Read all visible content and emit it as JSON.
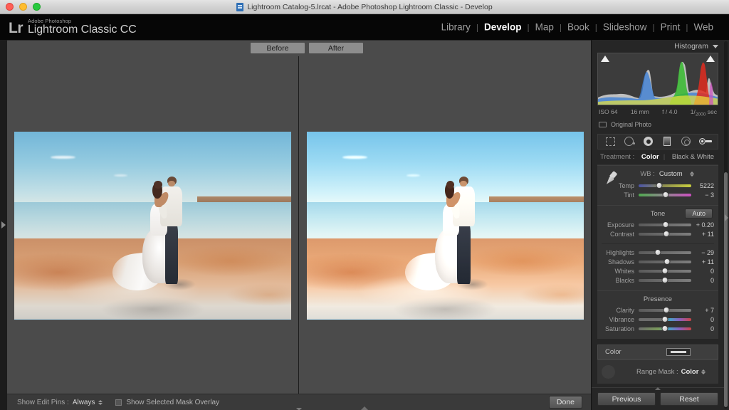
{
  "window": {
    "title": "Lightroom Catalog-5.lrcat - Adobe Photoshop Lightroom Classic - Develop",
    "doc_icon": "document-icon",
    "traffic": {
      "close": "close-button",
      "minimize": "minimize-button",
      "zoom": "zoom-button"
    }
  },
  "header": {
    "logo_mark": "Lr",
    "brand_sup": "Adobe Photoshop",
    "brand_name": "Lightroom Classic CC",
    "separator": "|",
    "modules": [
      {
        "label": "Library",
        "active": false
      },
      {
        "label": "Develop",
        "active": true
      },
      {
        "label": "Map",
        "active": false
      },
      {
        "label": "Book",
        "active": false
      },
      {
        "label": "Slideshow",
        "active": false
      },
      {
        "label": "Print",
        "active": false
      },
      {
        "label": "Web",
        "active": false
      }
    ]
  },
  "viewer": {
    "before_label": "Before",
    "after_label": "After"
  },
  "toolbar": {
    "show_edit_pins_label": "Show Edit Pins :",
    "show_edit_pins_value": "Always",
    "mask_overlay_label": "Show Selected Mask Overlay",
    "mask_overlay_checked": false,
    "done_label": "Done"
  },
  "right_panel": {
    "histogram": {
      "title": "Histogram",
      "iso": "ISO 64",
      "focal": "16 mm",
      "aperture": "f / 4.0",
      "shutter_num": "1",
      "shutter_den": "2000",
      "shutter_unit": "sec",
      "original_photo_label": "Original Photo"
    },
    "tools": [
      {
        "name": "crop-overlay-tool"
      },
      {
        "name": "spot-removal-tool"
      },
      {
        "name": "red-eye-correction-tool"
      },
      {
        "name": "graduated-filter-tool"
      },
      {
        "name": "radial-filter-tool"
      },
      {
        "name": "adjustment-brush-tool"
      }
    ],
    "treatment": {
      "label": "Treatment :",
      "color": "Color",
      "bw": "Black & White",
      "active": "Color"
    },
    "white_balance": {
      "wb_label": "WB :",
      "wb_value": "Custom",
      "sliders": [
        {
          "label": "Temp",
          "value": "5222",
          "pos": 39,
          "track": "temp"
        },
        {
          "label": "Tint",
          "value": "− 3",
          "pos": 52,
          "track": "tint"
        }
      ]
    },
    "tone": {
      "title": "Tone",
      "auto_label": "Auto",
      "sliders": [
        {
          "label": "Exposure",
          "value": "+ 0.20",
          "pos": 52,
          "track": "grey"
        },
        {
          "label": "Contrast",
          "value": "+ 11",
          "pos": 53,
          "track": "grey"
        },
        {
          "label": "Highlights",
          "value": "− 29",
          "pos": 36,
          "track": "grey"
        },
        {
          "label": "Shadows",
          "value": "+ 11",
          "pos": 54,
          "track": "grey"
        },
        {
          "label": "Whites",
          "value": "0",
          "pos": 50,
          "track": "grey"
        },
        {
          "label": "Blacks",
          "value": "0",
          "pos": 50,
          "track": "grey"
        }
      ]
    },
    "presence": {
      "title": "Presence",
      "sliders": [
        {
          "label": "Clarity",
          "value": "+ 7",
          "pos": 53,
          "track": "grey"
        },
        {
          "label": "Vibrance",
          "value": "0",
          "pos": 50,
          "track": "vib"
        },
        {
          "label": "Saturation",
          "value": "0",
          "pos": 50,
          "track": "sat"
        }
      ]
    },
    "color_section": {
      "label": "Color",
      "swatch": "color-swatch-button"
    },
    "range_mask": {
      "label": "Range Mask :",
      "value": "Color"
    },
    "footer": {
      "previous_label": "Previous",
      "reset_label": "Reset"
    }
  }
}
